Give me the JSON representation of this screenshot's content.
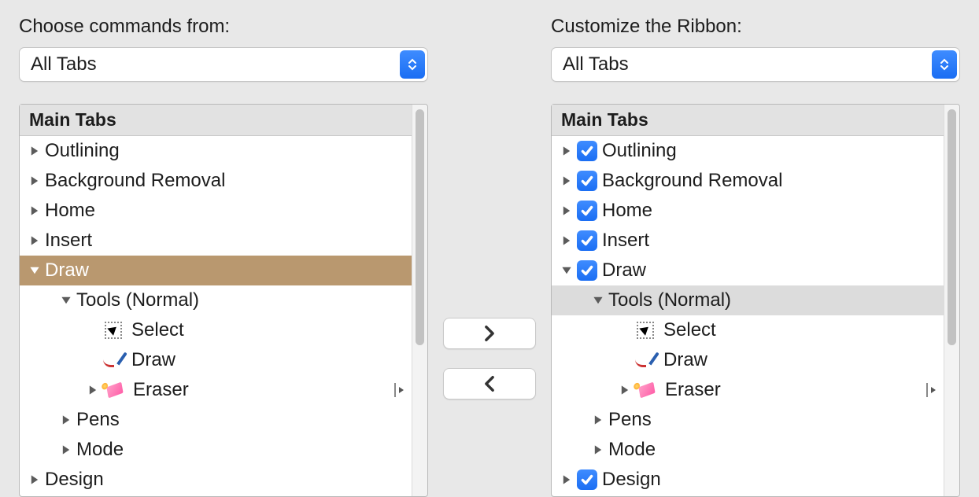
{
  "left": {
    "label": "Choose commands from:",
    "select": "All Tabs",
    "header": "Main Tabs",
    "items": {
      "outlining": "Outlining",
      "bgremoval": "Background Removal",
      "home": "Home",
      "insert": "Insert",
      "draw": "Draw",
      "toolsNormal": "Tools (Normal)",
      "select": "Select",
      "drawTool": "Draw",
      "eraser": "Eraser",
      "pens": "Pens",
      "mode": "Mode",
      "design": "Design"
    }
  },
  "right": {
    "label": "Customize the Ribbon:",
    "select": "All Tabs",
    "header": "Main Tabs",
    "items": {
      "outlining": "Outlining",
      "bgremoval": "Background Removal",
      "home": "Home",
      "insert": "Insert",
      "draw": "Draw",
      "toolsNormal": "Tools (Normal)",
      "select": "Select",
      "drawTool": "Draw",
      "eraser": "Eraser",
      "pens": "Pens",
      "mode": "Mode",
      "design": "Design"
    }
  }
}
